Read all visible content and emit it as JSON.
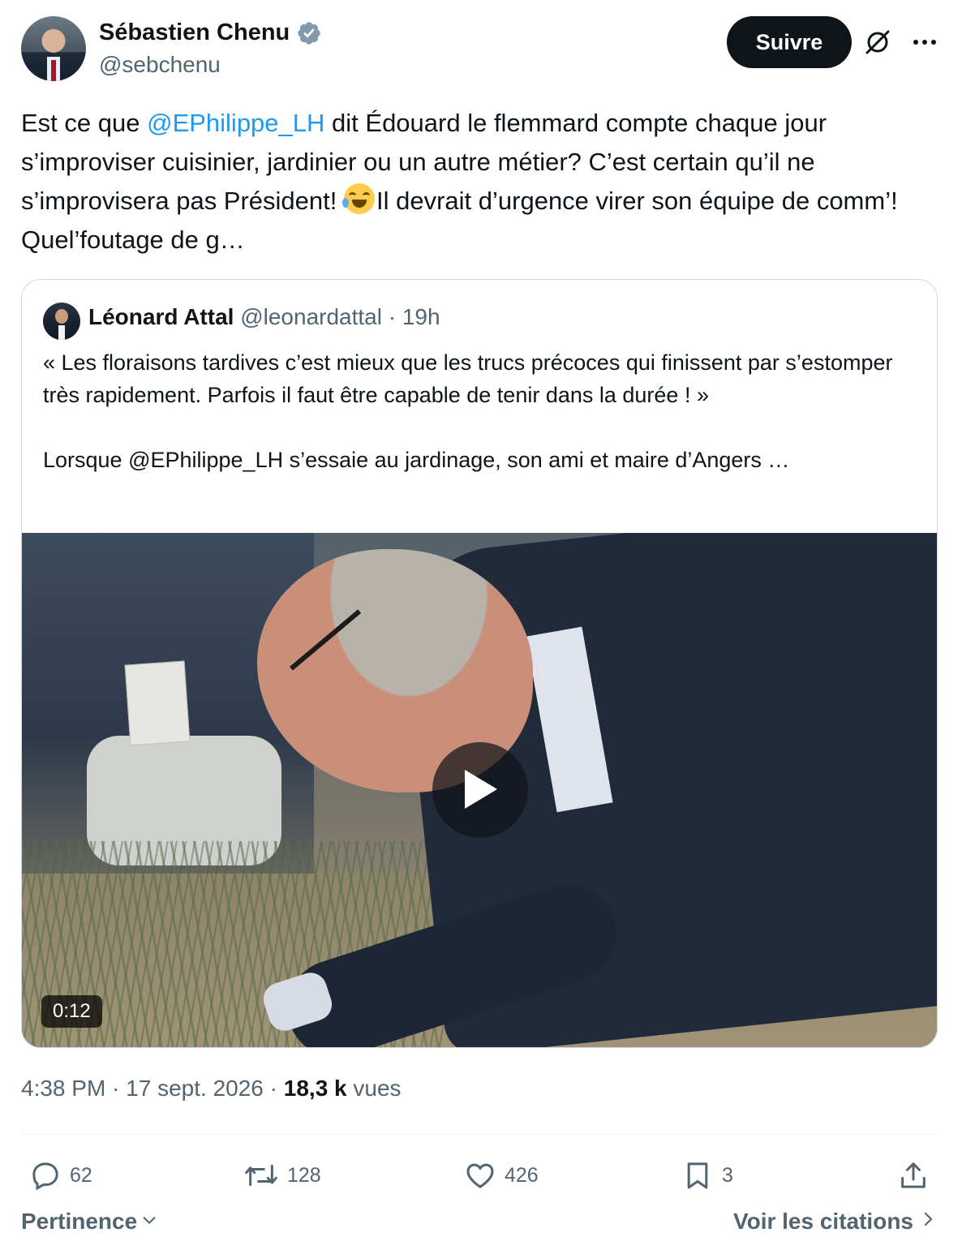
{
  "author": {
    "name": "Sébastien Chenu",
    "handle": "@sebchenu",
    "verified": true
  },
  "header": {
    "follow_label": "Suivre",
    "grok_icon": "grok-icon",
    "more_icon": "more-icon"
  },
  "tweet": {
    "text_before": "Est ce que ",
    "mention": "@EPhilippe_LH",
    "text_middle": " dit Édouard le flemmard compte  chaque jour s’improviser cuisinier, jardinier ou un autre métier? C’est certain qu’il ne s’improvisera pas Président! ",
    "emoji": "face-with-tears-of-joy",
    "text_after": "Il devrait d’urgence virer son équipe de comm’! Quel’foutage de g…"
  },
  "quote": {
    "name": "Léonard Attal",
    "handle": "@leonardattal",
    "separator": " · ",
    "time": "19h",
    "text": "« Les floraisons tardives c’est mieux que les trucs précoces qui finissent par s’estomper très rapidement. Parfois il faut être capable de tenir dans la durée ! »\n\nLorsque @EPhilippe_LH s’essaie au jardinage, son ami et maire d’Angers …",
    "video": {
      "duration": "0:12",
      "play_icon": "play-icon"
    }
  },
  "meta": {
    "time": "4:38 PM",
    "sep1": " · ",
    "date": "17 sept. 2026",
    "sep2": " · ",
    "views_count": "18,3 k",
    "views_label": " vues"
  },
  "actions": {
    "replies": "62",
    "reposts": "128",
    "likes": "426",
    "bookmarks": "3"
  },
  "footer": {
    "sort_label": "Pertinence",
    "quotes_link": "Voir les citations"
  },
  "colors": {
    "accent": "#1d9bf0",
    "text": "#0f1419",
    "muted": "#536471",
    "verified": "#829aab"
  }
}
